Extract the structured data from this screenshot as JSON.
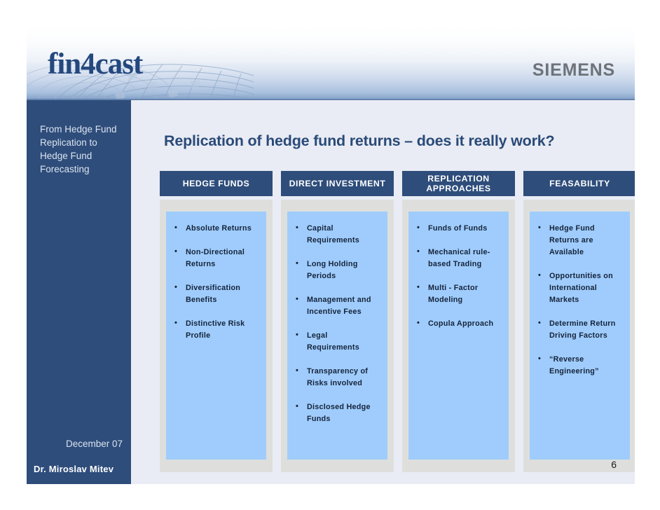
{
  "banner": {
    "logo_text": "fin4cast",
    "brand_text": "SIEMENS",
    "globe_icon": "globe-wireframe-icon"
  },
  "sidebar": {
    "subtitle": "From Hedge Fund Replication to Hedge Fund Forecasting",
    "date": "December 07",
    "author": "Dr. Miroslav Mitev"
  },
  "main": {
    "title": "Replication of hedge fund returns – does it really work?",
    "page_number": "6",
    "columns": [
      {
        "header": "HEDGE FUNDS",
        "bullets": [
          "Absolute Returns",
          "Non-Directional Returns",
          "Diversification Benefits",
          "Distinctive Risk Profile"
        ]
      },
      {
        "header": "DIRECT INVESTMENT",
        "bullets": [
          "Capital Requirements",
          "Long Holding Periods",
          "Management  and Incentive Fees",
          "Legal Requirements",
          "Transparency of Risks involved",
          "Disclosed Hedge Funds"
        ]
      },
      {
        "header": "REPLICATION APPROACHES",
        "bullets": [
          "Funds of Funds",
          "Mechanical rule-based Trading",
          "Multi - Factor Modeling",
          "Copula Approach"
        ]
      },
      {
        "header": "FEASABILITY",
        "bullets": [
          "Hedge Fund Returns  are Available",
          "Opportunities on International Markets",
          "Determine Return Driving Factors",
          "“Reverse Engineering”"
        ]
      }
    ]
  },
  "colors": {
    "navy": "#2e4d7b",
    "light_blue": "#9fccfc",
    "gray_frame": "#dedfdc",
    "background": "#e9ecf4",
    "title_blue": "#2a4a78",
    "siemens_gray": "#6d7378",
    "logo_blue": "#24487e"
  }
}
